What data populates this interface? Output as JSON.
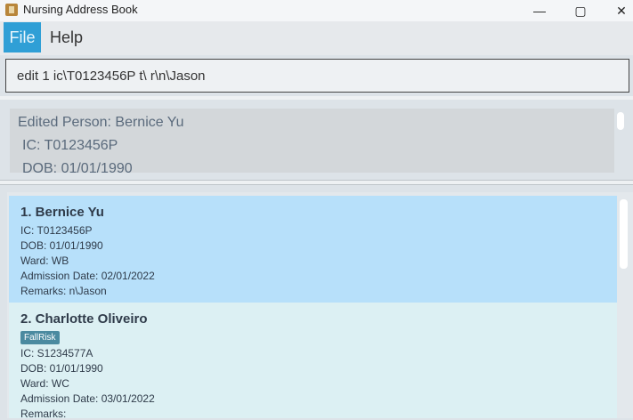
{
  "window": {
    "title": "Nursing Address Book"
  },
  "menu": {
    "file": "File",
    "help": "Help"
  },
  "command": {
    "value": "edit 1 ic\\T0123456P t\\ r\\n\\Jason"
  },
  "result": {
    "lines": [
      "Edited Person: Bernice Yu",
      "IC: T0123456P",
      "DOB: 01/01/1990"
    ]
  },
  "persons": [
    {
      "title": "1.  Bernice Yu",
      "tags": [],
      "ic": "IC: T0123456P",
      "dob": "DOB: 01/01/1990",
      "ward": "Ward: WB",
      "admission": "Admission Date: 02/01/2022",
      "remarks": "Remarks: n\\Jason"
    },
    {
      "title": "2.  Charlotte Oliveiro",
      "tags": [
        "FallRisk"
      ],
      "ic": "IC: S1234577A",
      "dob": "DOB: 01/01/1990",
      "ward": "Ward: WC",
      "admission": "Admission Date: 03/01/2022",
      "remarks": "Remarks:"
    }
  ]
}
